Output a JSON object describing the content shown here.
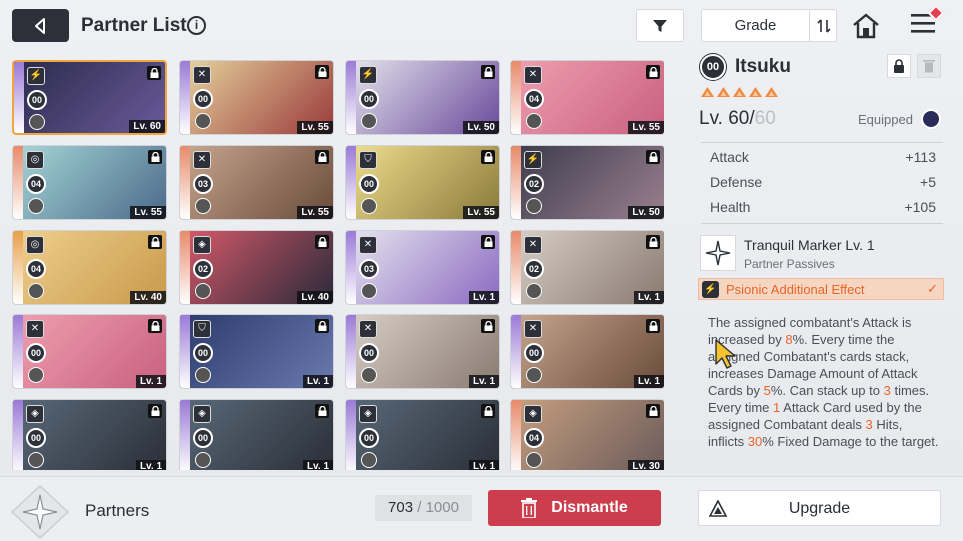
{
  "header": {
    "title": "Partner List",
    "info_glyph": "i",
    "grade_label": "Grade"
  },
  "colors": {
    "accent_orange": "#e8652a",
    "selected_border": "#f0a63a",
    "dismantle_red": "#cc3d4d",
    "dark": "#2d3038"
  },
  "cards": [
    {
      "rank": "00",
      "level": "Lv. 60",
      "type_icon": "lightning-icon",
      "strip": "#9a7ad6",
      "art": [
        "#2a2a4a",
        "#6a5a9a"
      ],
      "selected": true
    },
    {
      "rank": "00",
      "level": "Lv. 55",
      "type_icon": "swords-icon",
      "strip": "#9a7ad6",
      "art": [
        "#e8d6a0",
        "#9a3a3a"
      ],
      "selected": false
    },
    {
      "rank": "00",
      "level": "Lv. 50",
      "type_icon": "lightning-icon",
      "strip": "#9a7ad6",
      "art": [
        "#e6e6ee",
        "#6a4a9a"
      ],
      "selected": false
    },
    {
      "rank": "04",
      "level": "Lv. 55",
      "type_icon": "swords-icon",
      "strip": "#e88a6a",
      "art": [
        "#f0a0b0",
        "#c86080"
      ],
      "selected": false
    },
    {
      "rank": "04",
      "level": "Lv. 55",
      "type_icon": "circle-icon",
      "strip": "#e88a6a",
      "art": [
        "#a8d8d8",
        "#4a6a8a"
      ],
      "selected": false
    },
    {
      "rank": "03",
      "level": "Lv. 55",
      "type_icon": "swords-icon",
      "strip": "#e88a6a",
      "art": [
        "#c8a890",
        "#6a4a3a"
      ],
      "selected": false
    },
    {
      "rank": "00",
      "level": "Lv. 55",
      "type_icon": "shield-icon",
      "strip": "#9a7ad6",
      "art": [
        "#f0e090",
        "#8a7a3a"
      ],
      "selected": false
    },
    {
      "rank": "02",
      "level": "Lv. 50",
      "type_icon": "lightning-icon",
      "strip": "#e88a6a",
      "art": [
        "#3a3a4a",
        "#9a8090"
      ],
      "selected": false
    },
    {
      "rank": "04",
      "level": "Lv. 40",
      "type_icon": "circle-icon",
      "strip": "#e8a04a",
      "art": [
        "#f0d090",
        "#c89a4a"
      ],
      "selected": false
    },
    {
      "rank": "02",
      "level": "Lv. 40",
      "type_icon": "diamond-icon",
      "strip": "#e88a6a",
      "art": [
        "#d85a6a",
        "#2a2a3a"
      ],
      "selected": false
    },
    {
      "rank": "03",
      "level": "Lv. 1",
      "type_icon": "swords-icon",
      "strip": "#9a7ad6",
      "art": [
        "#e8e6f0",
        "#8a6ac0"
      ],
      "selected": false
    },
    {
      "rank": "02",
      "level": "Lv. 1",
      "type_icon": "swords-icon",
      "strip": "#e88a6a",
      "art": [
        "#d8d0c8",
        "#8a7a70"
      ],
      "selected": false
    },
    {
      "rank": "00",
      "level": "Lv. 1",
      "type_icon": "swords-icon",
      "strip": "#9a7ad6",
      "art": [
        "#f0a0b0",
        "#c86080"
      ],
      "selected": false
    },
    {
      "rank": "00",
      "level": "Lv. 1",
      "type_icon": "shield-icon",
      "strip": "#9a7ad6",
      "art": [
        "#2a3a6a",
        "#6a7ab0"
      ],
      "selected": false
    },
    {
      "rank": "00",
      "level": "Lv. 1",
      "type_icon": "swords-icon",
      "strip": "#9a7ad6",
      "art": [
        "#d8d0c8",
        "#8a7a70"
      ],
      "selected": false
    },
    {
      "rank": "00",
      "level": "Lv. 1",
      "type_icon": "swords-icon",
      "strip": "#9a7ad6",
      "art": [
        "#c8a890",
        "#6a4a3a"
      ],
      "selected": false
    },
    {
      "rank": "00",
      "level": "Lv. 1",
      "type_icon": "diamond-icon",
      "strip": "#9a7ad6",
      "art": [
        "#5a6a7a",
        "#2a2e36"
      ],
      "selected": false
    },
    {
      "rank": "00",
      "level": "Lv. 1",
      "type_icon": "diamond-icon",
      "strip": "#9a7ad6",
      "art": [
        "#5a6a7a",
        "#2a2e36"
      ],
      "selected": false
    },
    {
      "rank": "00",
      "level": "Lv. 1",
      "type_icon": "diamond-icon",
      "strip": "#9a7ad6",
      "art": [
        "#5a6a7a",
        "#2a2e36"
      ],
      "selected": false
    },
    {
      "rank": "04",
      "level": "Lv. 30",
      "type_icon": "diamond-icon",
      "strip": "#e88a6a",
      "art": [
        "#c8a080",
        "#6a5a5a"
      ],
      "selected": false
    }
  ],
  "detail": {
    "rank": "00",
    "name": "Itsuku",
    "stars": 5,
    "level_prefix": "Lv. 60/",
    "level_max": "60",
    "equipped_label": "Equipped",
    "stats": [
      {
        "label": "Attack",
        "value": "+113"
      },
      {
        "label": "Defense",
        "value": "+5"
      },
      {
        "label": "Health",
        "value": "+105"
      }
    ],
    "skill_name": "Tranquil Marker Lv. 1",
    "skill_sub": "Partner Passives",
    "effect_label": "Psionic Additional Effect",
    "desc_parts": [
      "The assigned combatant's Attack is increased by ",
      "8",
      "%. Every time the assigned Combatant's cards stack, increases Damage Amount of Attack Cards by ",
      "5",
      "%. Can stack up to ",
      "3",
      " times. Every time ",
      "1",
      " Attack Card used by the assigned Combatant deals ",
      "3",
      " Hits, inflicts ",
      "30",
      "% Fixed Damage to the target."
    ]
  },
  "footer": {
    "partners_label": "Partners",
    "count_current": "703",
    "count_sep": " / ",
    "count_max": "1000",
    "dismantle_label": "Dismantle",
    "upgrade_label": "Upgrade"
  }
}
